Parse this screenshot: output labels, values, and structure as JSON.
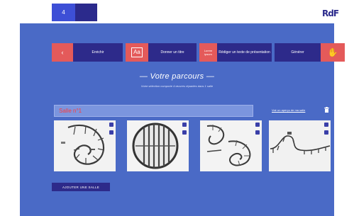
{
  "top": {
    "step": "4",
    "logo": "RdF"
  },
  "actions": {
    "back_label": "Enrichir",
    "back_icon": "‹",
    "title_label": "Donner un titre",
    "title_icon": "Aa",
    "text_icon_line1": "Lorem",
    "text_icon_line2": "ipsum",
    "text_label": "Rédiger un texte de présentation",
    "generate_label": "Générer",
    "generate_icon": "✋"
  },
  "parcours": {
    "title": "— Votre parcours —",
    "subtitle": "Votre sélection comporte 4 œuvres réparties dans 1 salle"
  },
  "salle": {
    "name": "Salle n°1",
    "preview_link": "Voir un aperçu de ma salle"
  },
  "add_salle_label": "AJOUTER UNE SALLE",
  "colors": {
    "accent": "#e45a5a",
    "navy": "#2d2a8a",
    "blue": "#4a6ac6"
  }
}
